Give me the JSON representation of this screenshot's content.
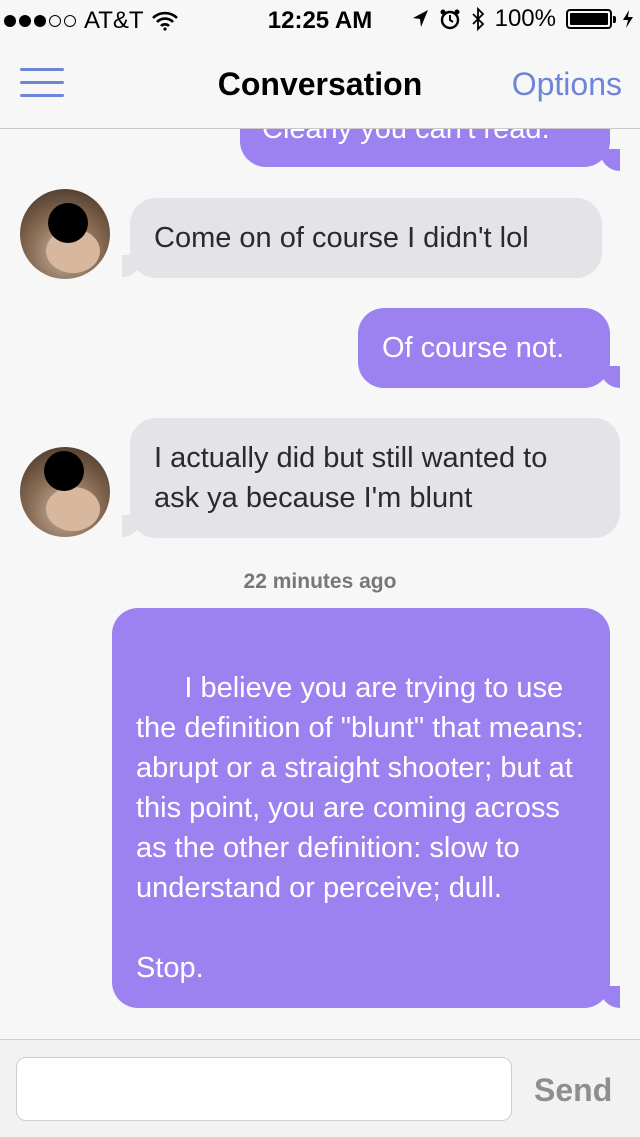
{
  "status_bar": {
    "carrier": "AT&T",
    "time": "12:25 AM",
    "battery": "100%",
    "icons": [
      "signal-dots-icon",
      "wifi-icon",
      "location-arrow-icon",
      "alarm-icon",
      "bluetooth-icon",
      "battery-icon",
      "charging-bolt-icon"
    ]
  },
  "nav": {
    "title": "Conversation",
    "options_label": "Options"
  },
  "messages": [
    {
      "direction": "outgoing",
      "text": "Clearly you can't read."
    },
    {
      "direction": "incoming",
      "text": "Come on of course I didn't lol"
    },
    {
      "direction": "outgoing",
      "text": "Of course not."
    },
    {
      "direction": "incoming",
      "text": "I actually did but still wanted to ask ya because I'm blunt"
    },
    {
      "direction": "outgoing",
      "text": "I believe you are trying to use the definition of \"blunt\" that means: abrupt or a straight shooter; but at this point, you are coming across as the other definition: slow to understand or perceive; dull.\n\nStop."
    }
  ],
  "timestamp": "22 minutes ago",
  "compose": {
    "value": "",
    "send_label": "Send"
  },
  "colors": {
    "accent": "#6e84d6",
    "outgoing_bubble": "#9b82f0",
    "incoming_bubble": "#e3e3e8"
  }
}
